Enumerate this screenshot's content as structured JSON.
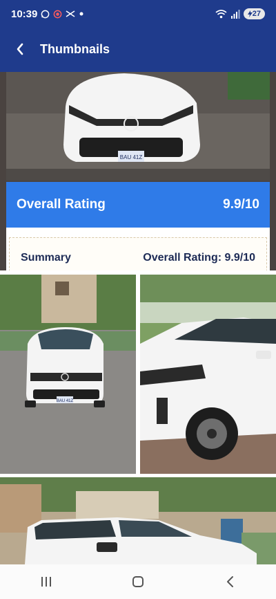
{
  "status_bar": {
    "time": "10:39",
    "battery": "27",
    "icons": [
      "whatsapp-icon",
      "record-icon",
      "link-icon",
      "dot-icon",
      "wifi-icon",
      "signal-icon"
    ]
  },
  "header": {
    "title": "Thumbnails",
    "back_icon": "chevron-left-icon"
  },
  "rating": {
    "label": "Overall Rating",
    "value": "9.9/10"
  },
  "summary": {
    "label": "Summary",
    "overall_label": "Overall Rating:",
    "overall_value": "9.9/10"
  },
  "images": [
    {
      "name": "thumbnail-front-top",
      "plate": "BAU 41Z"
    },
    {
      "name": "thumbnail-front-left",
      "plate": "BAU 41Z"
    },
    {
      "name": "thumbnail-side-front"
    },
    {
      "name": "thumbnail-side-bottom"
    }
  ],
  "nav": {
    "recent_icon": "recents-icon",
    "home_icon": "home-icon",
    "back_icon": "back-triangle-icon"
  },
  "colors": {
    "app_bar": "#1f3b8c",
    "rating_bar": "#2f7be8",
    "car_white": "#f4f4f4"
  }
}
